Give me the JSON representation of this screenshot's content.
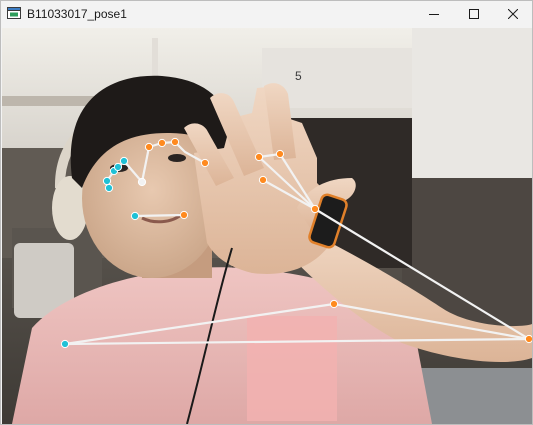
{
  "window": {
    "title": "B11033017_pose1",
    "icons": {
      "app": "window-app-icon",
      "minimize": "minimize-icon",
      "maximize": "maximize-icon",
      "close": "close-icon"
    }
  },
  "content": {
    "type": "webcam-frame-with-pose-landmarks",
    "visible_texts": {
      "locker_number": "5"
    },
    "colors": {
      "skeleton_line": "#f2f2f2",
      "left_side_point": "#1fc1d6",
      "right_side_point": "#ff8a1f",
      "wall": "#eceae6",
      "shirt": "#e9b9b7"
    }
  }
}
